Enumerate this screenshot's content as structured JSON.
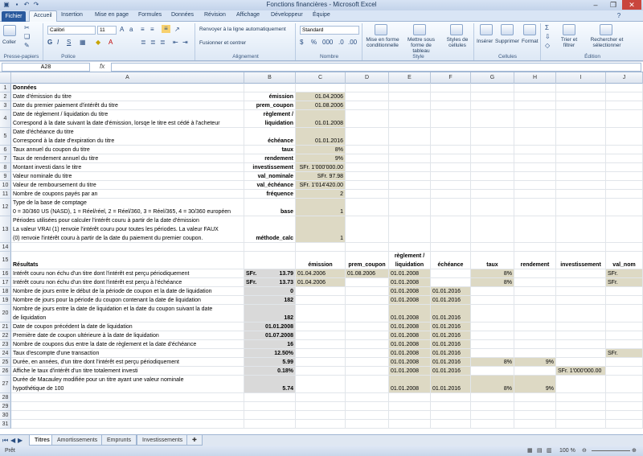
{
  "window": {
    "title": "Fonctions financières - Microsoft Excel"
  },
  "tabs": [
    "Fichier",
    "Accueil",
    "Insertion",
    "Mise en page",
    "Formules",
    "Données",
    "Révision",
    "Affichage",
    "Développeur",
    "Équipe"
  ],
  "ribbon": {
    "clipboard": {
      "paste": "Coller",
      "label": "Presse-papiers"
    },
    "font": {
      "name": "Calibri",
      "size": "11",
      "label": "Police"
    },
    "alignment": {
      "wrap": "Renvoyer à la ligne automatiquement",
      "merge": "Fusionner et centrer",
      "label": "Alignement"
    },
    "number": {
      "format": "Standard",
      "label": "Nombre"
    },
    "style": {
      "cond": "Mise en forme conditionnelle",
      "table": "Mettre sous forme de tableau",
      "cellstyles": "Styles de cellules",
      "label": "Style"
    },
    "cells": {
      "insert": "Insérer",
      "delete": "Supprimer",
      "format": "Format",
      "label": "Cellules"
    },
    "edit": {
      "sort": "Trier et filtrer",
      "find": "Rechercher et sélectionner",
      "label": "Édition"
    }
  },
  "formula": {
    "namebox": "A28",
    "fx": "fx",
    "value": ""
  },
  "columns": [
    "A",
    "B",
    "C",
    "D",
    "E",
    "F",
    "G",
    "H",
    "I",
    "J"
  ],
  "rows": [
    {
      "n": "1",
      "A": "Données",
      "bold": true
    },
    {
      "n": "2",
      "A": "Date d'émission du titre",
      "B": "émission",
      "C": "01.04.2006"
    },
    {
      "n": "3",
      "A": "Date du premier paiement d'intérêt du titre",
      "B": "prem_coupon",
      "C": "01.08.2006"
    },
    {
      "n": "4",
      "A": "Date de règlement / liquidation du titre",
      "A2": "Correspond à la date suivant la date d'émission, lorsqe le titre est cédé à l'acheteur",
      "B": "règlement /",
      "B2": "liquidation",
      "C": "01.01.2008"
    },
    {
      "n": "5",
      "A": "Date d'échéance du titre",
      "A2": "Correspond à la date d'expiration du titre",
      "B": "échéance",
      "C": "01.01.2016"
    },
    {
      "n": "6",
      "A": "Taux annuel du coupon du titre",
      "B": "taux",
      "C": "8%"
    },
    {
      "n": "7",
      "A": "Taux de rendement annuel du titre",
      "B": "rendement",
      "C": "9%"
    },
    {
      "n": "8",
      "A": "Montant investi dans le titre",
      "B": "investissement",
      "C": "SFr.  1'000'000.00"
    },
    {
      "n": "9",
      "A": "Valeur nominale du titre",
      "B": "val_nominale",
      "C": "SFr.         97.98"
    },
    {
      "n": "10",
      "A": "Valeur de remboursement du titre",
      "B": "val_échéance",
      "C": "SFr.  1'014'420.00"
    },
    {
      "n": "11",
      "A": "Nombre de coupons payés par an",
      "B": "fréquence",
      "C": "2"
    },
    {
      "n": "12",
      "A": "Type de la base de comptage",
      "A2": "0 = 30/360 US (NASD), 1 = Réel/réel, 2 = Réel/360, 3 = Réel/365, 4 = 30/360 européen",
      "B": "base",
      "C": "1"
    },
    {
      "n": "13",
      "A": "Périodes utilisées pour calculer l'intérêt couru à partir de la date d'émission",
      "A2": "La valeur VRAI (1) renvoie l'intérêt couru pour toutes les périodes. La valeur FAUX",
      "A3": "(0) renvoie l'intérêt couru à partir de la date du paiement du premier coupon.",
      "B": "méthode_calc",
      "C": "1"
    },
    {
      "n": "14"
    },
    {
      "n": "15",
      "A": "Résultats",
      "C": "émission",
      "D": "prem_coupon",
      "E": "règlement /",
      "E2": "liquidation",
      "F": "échéance",
      "G": "taux",
      "H": "rendement",
      "I": "investissement",
      "J": "val_nom"
    },
    {
      "n": "16",
      "A": "Intérêt couru non échu d'un titre dont l'intérêt est perçu périodiquement",
      "Bc": "SFr.",
      "B": "13.79",
      "C": "01.04.2006",
      "D": "01.08.2006",
      "E": "01.01.2008",
      "G": "8%",
      "J": "SFr."
    },
    {
      "n": "17",
      "A": "Intérêt couru non échu d'un titre dont l'intérêt est perçu à l'échéance",
      "Bc": "SFr.",
      "B": "13.73",
      "C": "01.04.2006",
      "E": "01.01.2008",
      "G": "8%",
      "J": "SFr."
    },
    {
      "n": "18",
      "A": "Nombre de jours entre le début de la période de coupon et la date de liquidation",
      "B": "0",
      "E": "01.01.2008",
      "F": "01.01.2016"
    },
    {
      "n": "19",
      "A": "Nombre de jours pour la période du coupon contenant la date de liquidation",
      "B": "182",
      "E": "01.01.2008",
      "F": "01.01.2016"
    },
    {
      "n": "20",
      "A": "Nombre de jours entre la date de liquidation et la date du coupon suivant la date",
      "A2": "de liquidation",
      "B": "182",
      "E": "01.01.2008",
      "F": "01.01.2016"
    },
    {
      "n": "21",
      "A": "Date de coupon précédent la date de liquidation",
      "B": "01.01.2008",
      "E": "01.01.2008",
      "F": "01.01.2016"
    },
    {
      "n": "22",
      "A": "Première date de coupon ultérieure à la date de liquidation",
      "B": "01.07.2008",
      "E": "01.01.2008",
      "F": "01.01.2016"
    },
    {
      "n": "23",
      "A": "Nombre de coupons dus entre la date de règlement et la date d'échéance",
      "B": "16",
      "E": "01.01.2008",
      "F": "01.01.2016"
    },
    {
      "n": "24",
      "A": "Taux d'escompte d'une transaction",
      "B": "12.50%",
      "E": "01.01.2008",
      "F": "01.01.2016",
      "J": "SFr."
    },
    {
      "n": "25",
      "A": "Durée, en années, d'un titre dont l'intérêt est perçu périodiquement",
      "B": "5.99",
      "E": "01.01.2008",
      "F": "01.01.2016",
      "G": "8%",
      "H": "9%"
    },
    {
      "n": "26",
      "A": "Affiche le taux d'intérêt d'un titre totalement investi",
      "B": "0.18%",
      "E": "01.01.2008",
      "F": "01.01.2016",
      "I": "SFr.  1'000'000.00"
    },
    {
      "n": "27",
      "A": "Durée de Macauley modifiée pour un titre ayant une valeur nominale",
      "A2": "hypothétique de 100",
      "B": "5.74",
      "E": "01.01.2008",
      "F": "01.01.2016",
      "G": "8%",
      "H": "9%"
    },
    {
      "n": "28"
    },
    {
      "n": "29"
    },
    {
      "n": "30"
    },
    {
      "n": "31"
    }
  ],
  "sheets": [
    "Titres",
    "Amortissements",
    "Emprunts",
    "Investissements"
  ],
  "status": {
    "ready": "Prêt",
    "zoom": "100 %"
  }
}
